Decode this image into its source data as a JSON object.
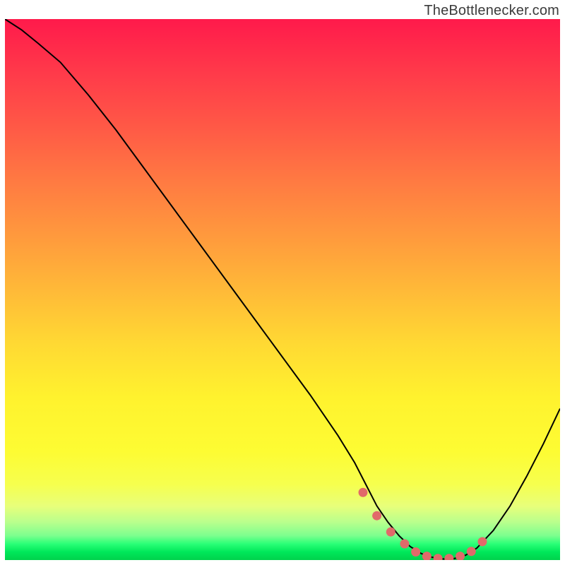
{
  "watermark": "TheBottlenecker.com",
  "colors": {
    "curve": "#000000",
    "marker_stroke": "#e16a6a",
    "marker_fill": "#e16a6a"
  },
  "chart_data": {
    "type": "line",
    "title": "",
    "xlabel": "",
    "ylabel": "",
    "xlim": [
      0,
      100
    ],
    "ylim": [
      0,
      100
    ],
    "grid": false,
    "legend": false,
    "series": [
      {
        "name": "bottleneck-curve",
        "x": [
          0,
          3,
          6,
          10,
          15,
          20,
          25,
          30,
          35,
          40,
          45,
          50,
          55,
          60,
          63,
          65,
          67,
          69,
          71,
          73,
          75,
          77,
          79,
          81,
          83,
          85,
          88,
          91,
          94,
          97,
          100
        ],
        "y": [
          100,
          98,
          95.5,
          92,
          86,
          79.5,
          72.5,
          65.5,
          58.5,
          51.5,
          44.5,
          37.5,
          30.5,
          23,
          18,
          14,
          10,
          7,
          4.5,
          2.5,
          1.2,
          0.5,
          0.2,
          0.3,
          0.9,
          2.2,
          5.5,
          10,
          15.5,
          21.5,
          28
        ]
      }
    ],
    "markers": {
      "name": "flat-region-dots",
      "x": [
        64.5,
        67,
        69.5,
        72,
        74,
        76,
        78,
        80,
        82,
        84,
        86
      ],
      "y": [
        12.5,
        8.2,
        5.2,
        3.0,
        1.5,
        0.7,
        0.3,
        0.3,
        0.7,
        1.6,
        3.4
      ]
    },
    "annotations": []
  }
}
